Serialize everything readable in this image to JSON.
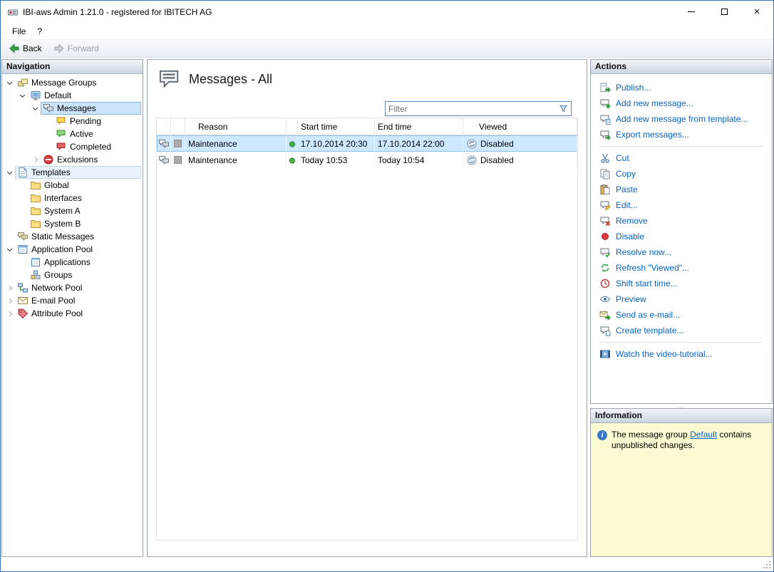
{
  "window": {
    "title": "IBI-aws Admin 1.21.0 - registered for IBITECH AG",
    "controls": [
      "minimize-icon",
      "maximize-icon",
      "close-icon"
    ]
  },
  "menu": {
    "items": [
      {
        "label": "File"
      },
      {
        "label": "?"
      }
    ]
  },
  "toolbar": {
    "items": [
      {
        "label": "Back",
        "icon": "back-arrow-icon",
        "enabled": true
      },
      {
        "label": "Forward",
        "icon": "forward-arrow-icon",
        "enabled": false
      }
    ]
  },
  "navigation": {
    "header": "Navigation",
    "items": [
      {
        "label": "Message Groups",
        "level": 0,
        "expander": "down",
        "icon": "message-groups-icon"
      },
      {
        "label": "Default",
        "level": 1,
        "expander": "down",
        "icon": "default-group-icon"
      },
      {
        "label": "Messages",
        "level": 2,
        "expander": "down",
        "icon": "messages-icon",
        "state": "selected"
      },
      {
        "label": "Pending",
        "level": 3,
        "expander": null,
        "icon": "pending-icon"
      },
      {
        "label": "Active",
        "level": 3,
        "expander": null,
        "icon": "active-icon"
      },
      {
        "label": "Completed",
        "level": 3,
        "expander": null,
        "icon": "completed-icon"
      },
      {
        "label": "Exclusions",
        "level": 2,
        "expander": "right",
        "icon": "exclusions-icon"
      },
      {
        "label": "Templates",
        "level": 0,
        "expander": "down",
        "icon": "templates-icon",
        "state": "highlighted"
      },
      {
        "label": "Global",
        "level": 1,
        "expander": null,
        "icon": "folder-icon"
      },
      {
        "label": "Interfaces",
        "level": 1,
        "expander": null,
        "icon": "folder-icon"
      },
      {
        "label": "System A",
        "level": 1,
        "expander": null,
        "icon": "folder-icon"
      },
      {
        "label": "System B",
        "level": 1,
        "expander": null,
        "icon": "folder-icon"
      },
      {
        "label": "Static Messages",
        "level": 0,
        "expander": null,
        "icon": "static-messages-icon"
      },
      {
        "label": "Application Pool",
        "level": 0,
        "expander": "down",
        "icon": "application-pool-icon"
      },
      {
        "label": "Applications",
        "level": 1,
        "expander": null,
        "icon": "applications-icon"
      },
      {
        "label": "Groups",
        "level": 1,
        "expander": null,
        "icon": "groups-icon"
      },
      {
        "label": "Network Pool",
        "level": 0,
        "expander": "right",
        "icon": "network-pool-icon"
      },
      {
        "label": "E-mail Pool",
        "level": 0,
        "expander": "right",
        "icon": "email-pool-icon"
      },
      {
        "label": "Attribute Pool",
        "level": 0,
        "expander": "right",
        "icon": "attribute-pool-icon"
      }
    ]
  },
  "main": {
    "title": "Messages - All",
    "title_icon": "messages-large-icon",
    "filter": {
      "placeholder": "Filter",
      "icon": "filter-funnel-icon"
    },
    "table": {
      "headers": [
        "",
        "",
        "Reason",
        "",
        "Start time",
        "End time",
        "Viewed"
      ],
      "rows": [
        {
          "icon": "message-row-icon",
          "thumb": "gray-square",
          "reason": "Maintenance",
          "status_icon": "status-dot-icon",
          "start": "17.10.2014 20:30",
          "end": "17.10.2014 22:00",
          "viewed_icon": "viewed-disabled-icon",
          "viewed": "Disabled",
          "selected": true
        },
        {
          "icon": "message-row-icon",
          "thumb": "gray-square",
          "reason": "Maintenance",
          "status_icon": "status-dot-icon",
          "start": "Today 10:53",
          "end": "Today 10:54",
          "viewed_icon": "viewed-disabled-icon",
          "viewed": "Disabled",
          "selected": false
        }
      ]
    }
  },
  "actions": {
    "header": "Actions",
    "groups": [
      [
        {
          "label": "Publish...",
          "icon": "publish-icon"
        },
        {
          "label": "Add new message...",
          "icon": "add-message-icon"
        },
        {
          "label": "Add new message from template...",
          "icon": "add-message-template-icon"
        },
        {
          "label": "Export messages...",
          "icon": "export-messages-icon"
        }
      ],
      [
        {
          "label": "Cut",
          "icon": "cut-icon"
        },
        {
          "label": "Copy",
          "icon": "copy-icon"
        },
        {
          "label": "Paste",
          "icon": "paste-icon"
        },
        {
          "label": "Edit...",
          "icon": "edit-icon"
        },
        {
          "label": "Remove",
          "icon": "remove-icon"
        },
        {
          "label": "Disable",
          "icon": "disable-icon"
        },
        {
          "label": "Resolve now...",
          "icon": "resolve-icon"
        },
        {
          "label": "Refresh \"Viewed\"...",
          "icon": "refresh-viewed-icon"
        },
        {
          "label": "Shift start time...",
          "icon": "shift-start-time-icon"
        },
        {
          "label": "Preview",
          "icon": "preview-icon"
        },
        {
          "label": "Send as e-mail...",
          "icon": "send-email-icon"
        },
        {
          "label": "Create template...",
          "icon": "create-template-icon"
        }
      ],
      [
        {
          "label": "Watch the video-tutorial...",
          "icon": "video-tutorial-icon"
        }
      ]
    ]
  },
  "information": {
    "header": "Information",
    "icon": "info-icon",
    "text_before": "The message group ",
    "link_text": "Default",
    "text_after": " contains unpublished changes."
  },
  "colors": {
    "action_link": "#0563c1",
    "row_selection": "#cde8ff",
    "tree_selection": "#cbe4f9",
    "info_background": "#fcfad3",
    "window_border": "#3a72b9"
  }
}
